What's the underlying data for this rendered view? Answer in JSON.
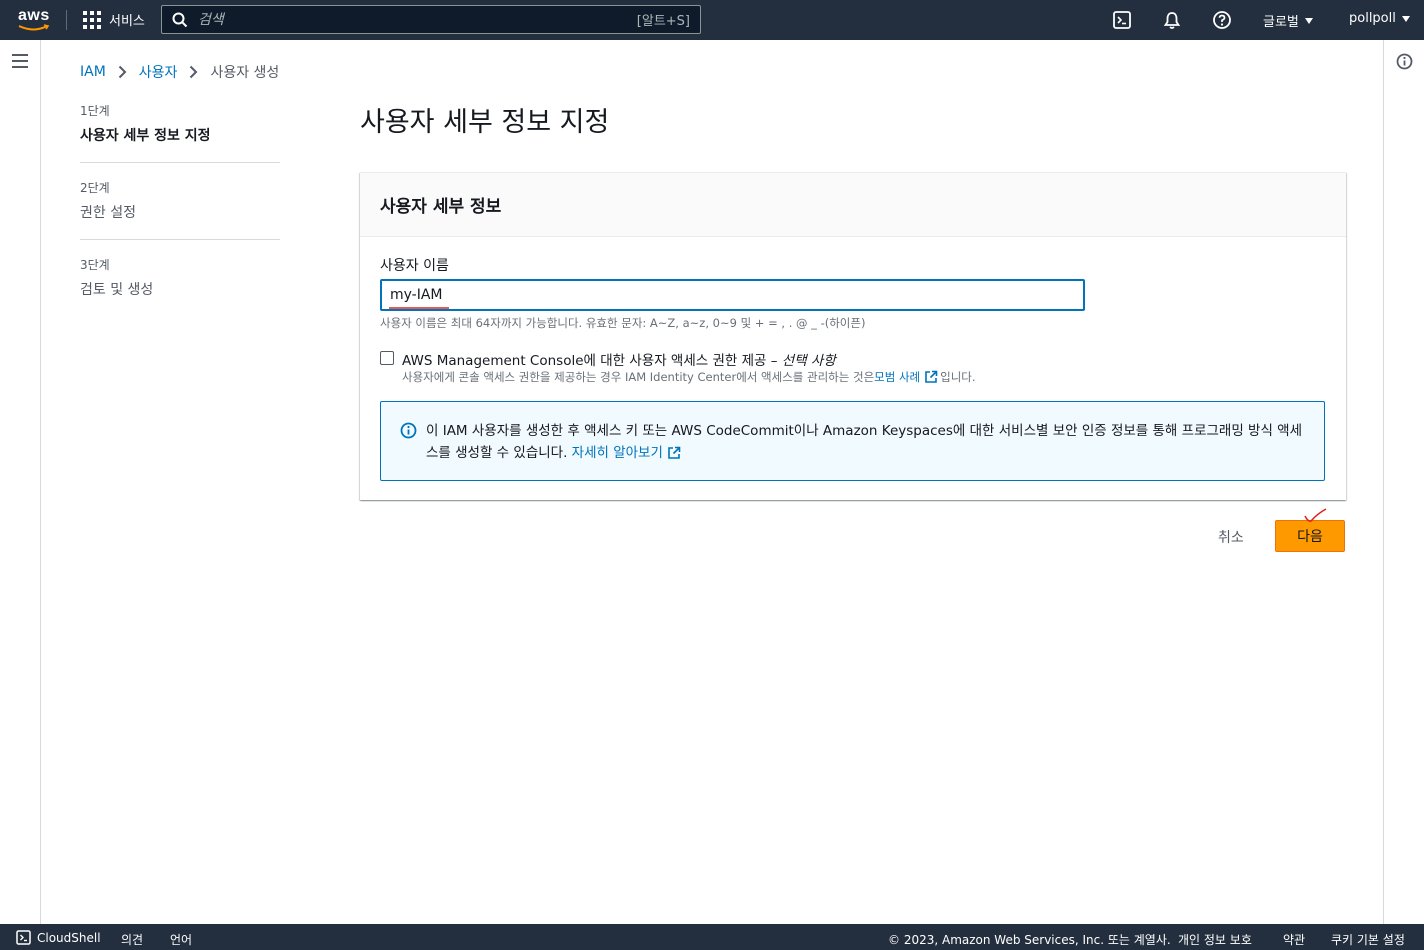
{
  "topnav": {
    "logo_text": "aws",
    "services_label": "서비스",
    "search_placeholder": "검색",
    "search_shortcut": "[알트+S]",
    "region_label": "글로벌",
    "account_label": "pollpoll"
  },
  "breadcrumb": {
    "items": [
      "IAM",
      "사용자",
      "사용자 생성"
    ]
  },
  "steps": [
    {
      "number": "1단계",
      "label": "사용자 세부 정보 지정"
    },
    {
      "number": "2단계",
      "label": "권한 설정"
    },
    {
      "number": "3단계",
      "label": "검토 및 생성"
    }
  ],
  "page_title": "사용자 세부 정보 지정",
  "panel": {
    "title": "사용자 세부 정보",
    "username_label": "사용자 이름",
    "username_value": "my-IAM",
    "username_hint": "사용자 이름은 최대 64자까지 가능합니다. 유효한 문자: A~Z, a~z, 0~9 및 + = , . @ _ -(하이픈)",
    "console_access_label": "AWS Management Console에 대한 사용자 액세스 권한 제공 – ",
    "console_access_optional": "선택 사항",
    "console_access_desc_prefix": "사용자에게 콘솔 액세스 권한을 제공하는 경우 IAM Identity Center에서 액세스를 관리하는 것은 ",
    "console_access_desc_link": "모범 사례",
    "console_access_desc_suffix": "입니다.",
    "alert_text": "이 IAM 사용자를 생성한 후 액세스 키 또는 AWS CodeCommit이나 Amazon Keyspaces에 대한 서비스별 보안 인증 정보를 통해 프로그래밍 방식 액세스를 생성할 수 있습니다. ",
    "alert_link": "자세히 알아보기"
  },
  "actions": {
    "cancel_label": "취소",
    "next_label": "다음"
  },
  "footer": {
    "cloudshell_label": "CloudShell",
    "feedback_label": "의견",
    "language_label": "언어",
    "copyright": "© 2023, Amazon Web Services, Inc. 또는 계열사.",
    "privacy_label": "개인 정보 보호",
    "terms_label": "약관",
    "cookie_label": "쿠키 기본 설정"
  },
  "colors": {
    "nav_bg": "#232f3e",
    "link": "#0073bb",
    "primary_button": "#ff9900",
    "alert_bg": "#f1faff"
  }
}
